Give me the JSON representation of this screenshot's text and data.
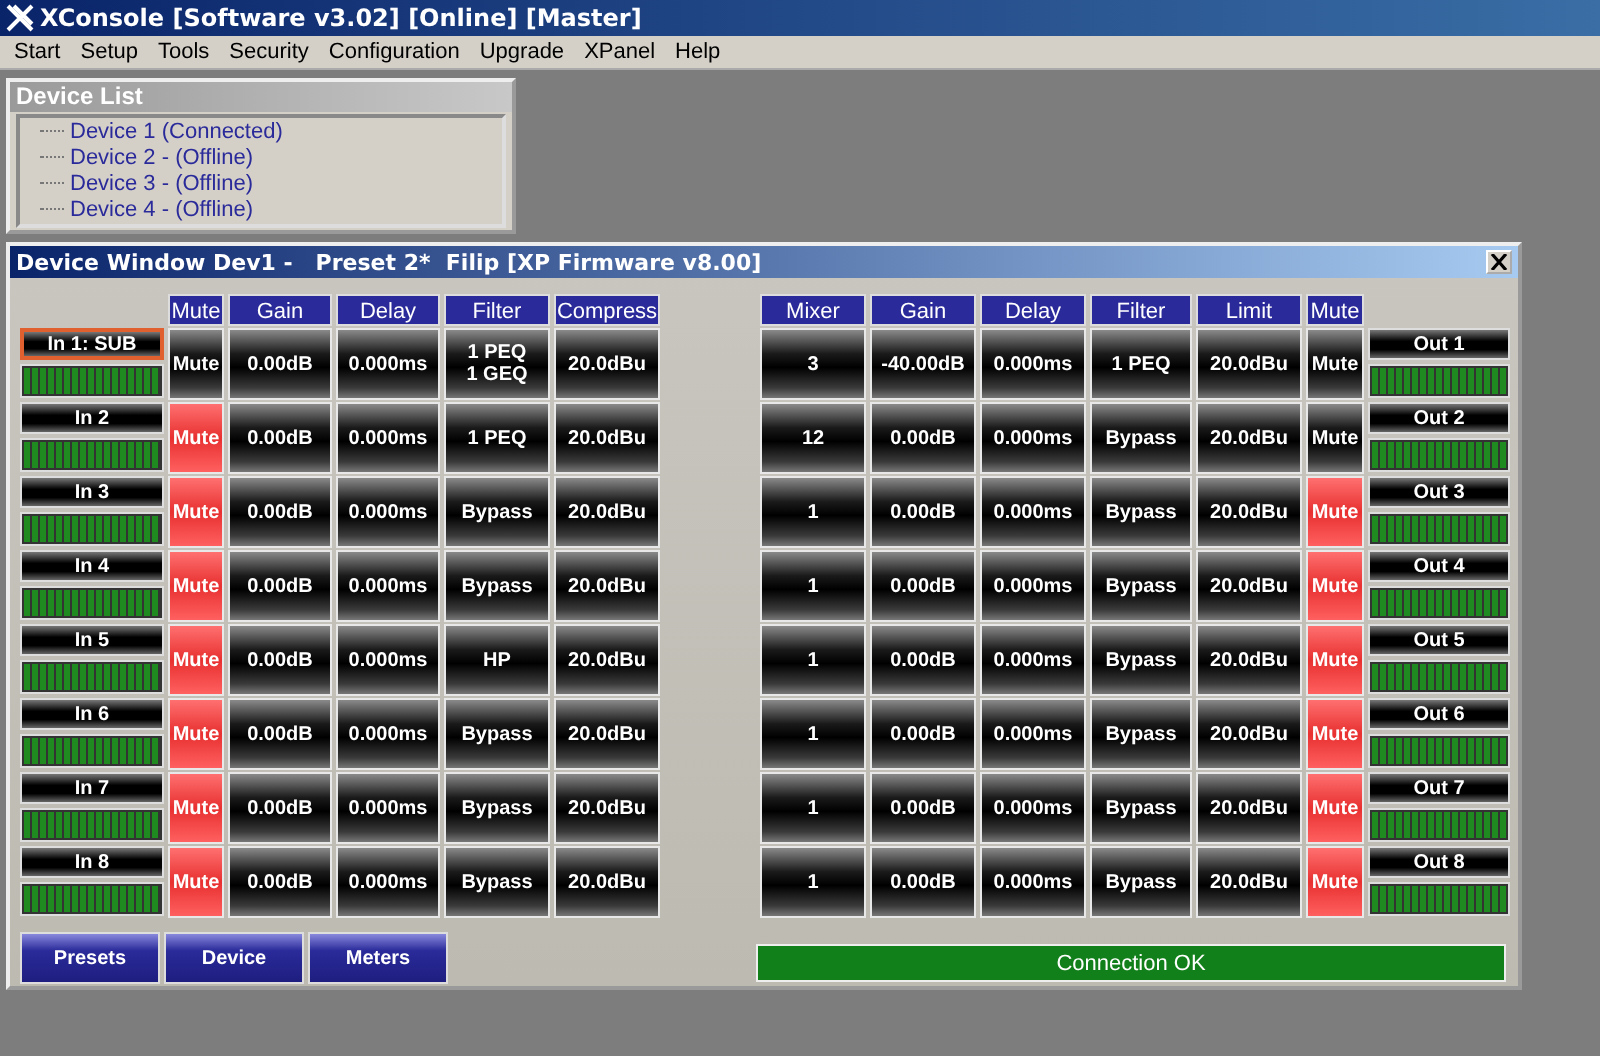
{
  "app_title": "XConsole [Software v3.02] [Online] [Master]",
  "menu": [
    "Start",
    "Setup",
    "Tools",
    "Security",
    "Configuration",
    "Upgrade",
    "XPanel",
    "Help"
  ],
  "device_list": {
    "title": "Device List",
    "items": [
      "Device 1 (Connected)",
      "Device 2 -  (Offline)",
      "Device 3 -  (Offline)",
      "Device 4 -  (Offline)"
    ]
  },
  "device_window": {
    "title": "Device Window Dev1 -   Preset 2*  Filip [XP Firmware v8.00]",
    "input_columns": [
      "Mute",
      "Gain",
      "Delay",
      "Filter",
      "Compress"
    ],
    "output_columns": [
      "Mixer",
      "Gain",
      "Delay",
      "Filter",
      "Limit",
      "Mute"
    ],
    "inputs": [
      {
        "name": "In 1: SUB",
        "selected": true,
        "level": 1,
        "mute": "Mute",
        "muted": false,
        "gain": "0.00dB",
        "delay": "0.000ms",
        "filter": "1 PEQ\n1 GEQ",
        "compress": "20.0dBu"
      },
      {
        "name": "In 2",
        "selected": false,
        "level": 1,
        "mute": "Mute",
        "muted": true,
        "gain": "0.00dB",
        "delay": "0.000ms",
        "filter": "1 PEQ",
        "compress": "20.0dBu"
      },
      {
        "name": "In 3",
        "selected": false,
        "level": 1,
        "mute": "Mute",
        "muted": true,
        "gain": "0.00dB",
        "delay": "0.000ms",
        "filter": "Bypass",
        "compress": "20.0dBu"
      },
      {
        "name": "In 4",
        "selected": false,
        "level": 1,
        "mute": "Mute",
        "muted": true,
        "gain": "0.00dB",
        "delay": "0.000ms",
        "filter": "Bypass",
        "compress": "20.0dBu"
      },
      {
        "name": "In 5",
        "selected": false,
        "level": 1,
        "mute": "Mute",
        "muted": true,
        "gain": "0.00dB",
        "delay": "0.000ms",
        "filter": "HP",
        "compress": "20.0dBu"
      },
      {
        "name": "In 6",
        "selected": false,
        "level": 1,
        "mute": "Mute",
        "muted": true,
        "gain": "0.00dB",
        "delay": "0.000ms",
        "filter": "Bypass",
        "compress": "20.0dBu"
      },
      {
        "name": "In 7",
        "selected": false,
        "level": 1,
        "mute": "Mute",
        "muted": true,
        "gain": "0.00dB",
        "delay": "0.000ms",
        "filter": "Bypass",
        "compress": "20.0dBu"
      },
      {
        "name": "In 8",
        "selected": false,
        "level": 1,
        "mute": "Mute",
        "muted": true,
        "gain": "0.00dB",
        "delay": "0.000ms",
        "filter": "Bypass",
        "compress": "20.0dBu"
      }
    ],
    "outputs": [
      {
        "mixer": "3",
        "gain": "-40.00dB",
        "delay": "0.000ms",
        "filter": "1 PEQ",
        "limit": "20.0dBu",
        "mute": "Mute",
        "muted": false,
        "name": "Out 1",
        "level": 1
      },
      {
        "mixer": "12",
        "gain": "0.00dB",
        "delay": "0.000ms",
        "filter": "Bypass",
        "limit": "20.0dBu",
        "mute": "Mute",
        "muted": false,
        "name": "Out 2",
        "level": 1
      },
      {
        "mixer": "1",
        "gain": "0.00dB",
        "delay": "0.000ms",
        "filter": "Bypass",
        "limit": "20.0dBu",
        "mute": "Mute",
        "muted": true,
        "name": "Out 3",
        "level": 1
      },
      {
        "mixer": "1",
        "gain": "0.00dB",
        "delay": "0.000ms",
        "filter": "Bypass",
        "limit": "20.0dBu",
        "mute": "Mute",
        "muted": true,
        "name": "Out 4",
        "level": 1
      },
      {
        "mixer": "1",
        "gain": "0.00dB",
        "delay": "0.000ms",
        "filter": "Bypass",
        "limit": "20.0dBu",
        "mute": "Mute",
        "muted": true,
        "name": "Out 5",
        "level": 1
      },
      {
        "mixer": "1",
        "gain": "0.00dB",
        "delay": "0.000ms",
        "filter": "Bypass",
        "limit": "20.0dBu",
        "mute": "Mute",
        "muted": true,
        "name": "Out 6",
        "level": 1
      },
      {
        "mixer": "1",
        "gain": "0.00dB",
        "delay": "0.000ms",
        "filter": "Bypass",
        "limit": "20.0dBu",
        "mute": "Mute",
        "muted": true,
        "name": "Out 7",
        "level": 1
      },
      {
        "mixer": "1",
        "gain": "0.00dB",
        "delay": "0.000ms",
        "filter": "Bypass",
        "limit": "20.0dBu",
        "mute": "Mute",
        "muted": true,
        "name": "Out 8",
        "level": 1
      }
    ],
    "buttons": [
      "Presets",
      "Device",
      "Meters"
    ],
    "status": "Connection OK"
  }
}
